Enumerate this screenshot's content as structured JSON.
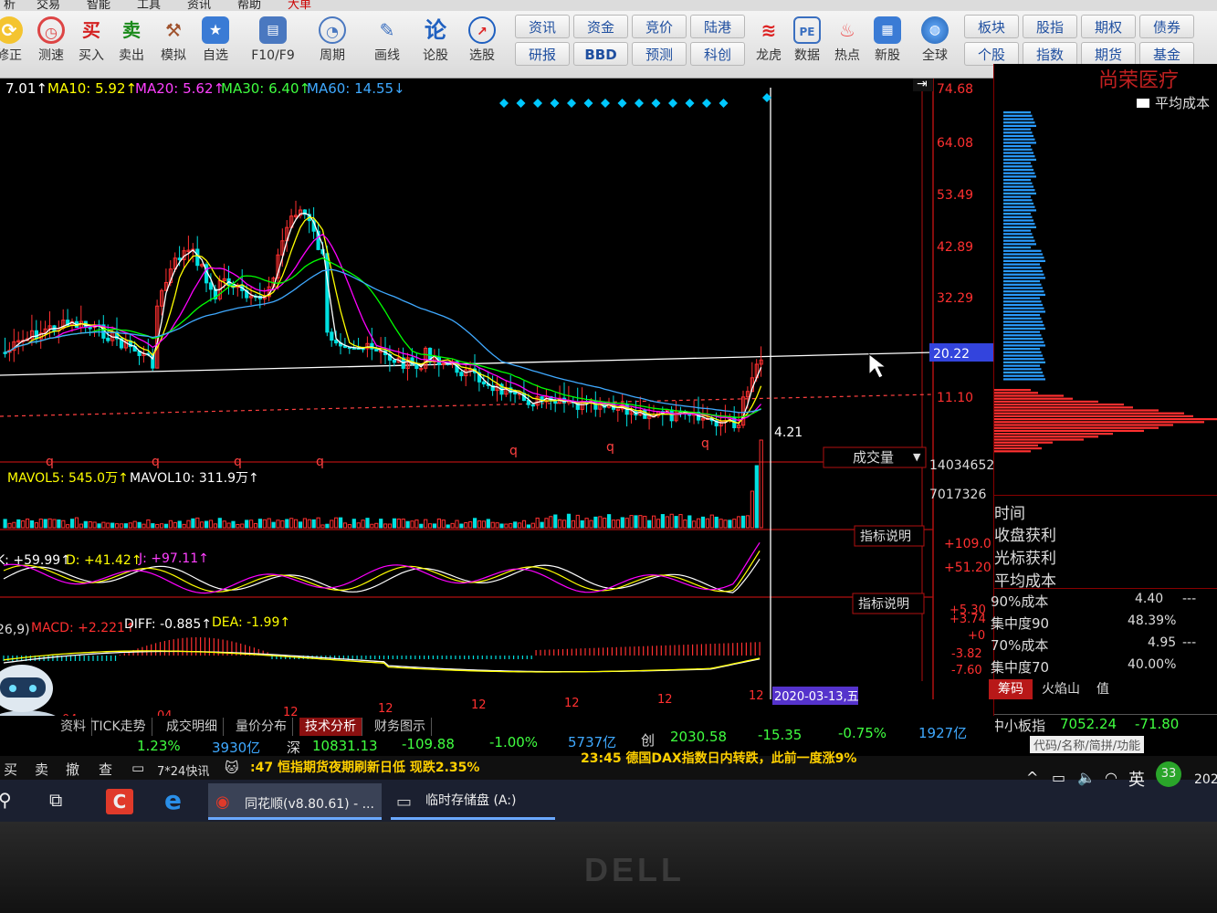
{
  "menu": [
    "析",
    "交易",
    "智能",
    "工具",
    "资讯",
    "帮助",
    "大单"
  ],
  "toolbar": [
    {
      "label": "修正",
      "icon": "refresh-icon"
    },
    {
      "label": "测速",
      "icon": "clock-icon"
    },
    {
      "label": "买入",
      "icon": "buy-icon",
      "glyph": "买"
    },
    {
      "label": "卖出",
      "icon": "sell-icon",
      "glyph": "卖"
    },
    {
      "label": "模拟",
      "icon": "hammer-icon"
    },
    {
      "label": "自选",
      "icon": "star-icon"
    },
    {
      "label": "F10/F9",
      "icon": "report-icon"
    },
    {
      "label": "周期",
      "icon": "period-icon"
    },
    {
      "label": "画线",
      "icon": "pencil-icon"
    },
    {
      "label": "论股",
      "icon": "discuss-icon",
      "glyph": "论"
    },
    {
      "label": "选股",
      "icon": "select-icon"
    }
  ],
  "quick_buttons": [
    [
      "资讯",
      "资金",
      "竞价",
      "陆港"
    ],
    [
      "研报",
      "BBD",
      "预测",
      "科创"
    ]
  ],
  "toolbar2": [
    {
      "label": "龙虎",
      "icon": "dragon-icon"
    },
    {
      "label": "数据",
      "icon": "pe-icon",
      "glyph": "PE"
    },
    {
      "label": "热点",
      "icon": "hot-icon"
    },
    {
      "label": "新股",
      "icon": "ipo-icon"
    },
    {
      "label": "全球",
      "icon": "globe-icon"
    }
  ],
  "quick_buttons2": [
    [
      "板块",
      "股指",
      "期权",
      "债券"
    ],
    [
      "个股",
      "指数",
      "期货",
      "基金"
    ]
  ],
  "ma_legend": {
    "ma5": "7.01↑",
    "ma10": "MA10: 5.92↑",
    "ma20": "MA20: 5.62↑",
    "ma30": "MA30: 6.40↑",
    "ma60": "MA60: 14.55↓"
  },
  "price_axis": [
    "74.68",
    "64.08",
    "53.49",
    "42.89",
    "32.29",
    "20.22",
    "11.10"
  ],
  "cursor_price": "20.22",
  "low_label": "4.21",
  "q_markers": [
    "q",
    "q",
    "q",
    "q",
    "q",
    "q",
    "q"
  ],
  "volume": {
    "panel_label": "成交量",
    "legend_mavol5": "MAVOL5: 545.0万↑",
    "legend_mavol10": "MAVOL10: 311.9万↑",
    "axis": [
      "14034652",
      "7017326"
    ]
  },
  "kdj": {
    "btn": "指标说明",
    "legend_k": "K: +59.99↑",
    "legend_d": "D: +41.42↑",
    "legend_j": "J: +97.11↑",
    "axis": [
      "+109.0",
      "+51.20"
    ]
  },
  "macd": {
    "btn": "指标说明",
    "legend_params": "26,9)",
    "legend_macd": "MACD: +2.221↑",
    "legend_diff": "DIFF: -0.885↑",
    "legend_dea": "DEA: -1.99↑",
    "axis": [
      "+5.30",
      "+3.74",
      "+0",
      "-3.82",
      "-7.60"
    ]
  },
  "x_axis": [
    "04",
    "04",
    "12",
    "12",
    "12",
    "12",
    "12",
    "12"
  ],
  "date_label": "2020-03-13,五",
  "tabs": [
    "资料",
    "TICK走势",
    "成交明细",
    "量价分布",
    "技术分析",
    "财务图示"
  ],
  "right_panel": {
    "stock_name": "尚荣医疗",
    "avg_cost_legend": "平均成本",
    "rows_title": [
      "时间",
      "收盘获利",
      "光标获利",
      "平均成本"
    ],
    "rows": [
      {
        "label": "90%成本",
        "value": "4.40",
        "extra": "---"
      },
      {
        "label": "集中度90",
        "value": "48.39%",
        "extra": ""
      },
      {
        "label": "70%成本",
        "value": "4.95",
        "extra": "---"
      },
      {
        "label": "集中度70",
        "value": "40.00%",
        "extra": ""
      }
    ],
    "tabs": [
      "筹码",
      "火焰山",
      "值"
    ]
  },
  "status1": {
    "left": "1.23%",
    "amt1": "3930亿",
    "sz_label": "深",
    "sz_val": "10831.13",
    "sz_chg": "-109.88",
    "sz_pct": "-1.00%",
    "sz_amt": "5737亿",
    "cy_label": "创",
    "cy_val": "2030.58",
    "cy_chg": "-15.35",
    "cy_pct": "-0.75%",
    "cy_amt": "1927亿",
    "zx_label": "中小板指",
    "zx_val": "7052.24",
    "zx_chg": "-71.80"
  },
  "status2": {
    "btns": [
      "买",
      "卖",
      "撤",
      "查"
    ],
    "news_label": "7*24快讯",
    "news1": ":47 恒指期货夜期刷新日低 现跌2.35%",
    "news2": "23:45 德国DAX指数日内转跌，此前一度涨9%",
    "search_hint": "代码/名称/简拼/功能"
  },
  "taskbar": {
    "app1": "同花顺(v8.80.61) - ...",
    "app2": "临时存储盘 (A:)",
    "ime": "英",
    "badge": "33",
    "clock": "202"
  },
  "bezel_logo": "DELL",
  "colors": {
    "ma5": "#ffffff",
    "ma10": "#ffff00",
    "ma20": "#ff00ff",
    "ma30": "#00ff00",
    "ma60": "#3fa9ff",
    "up": "#ff3030",
    "down": "#00e0e0",
    "axis": "#ff2020"
  }
}
